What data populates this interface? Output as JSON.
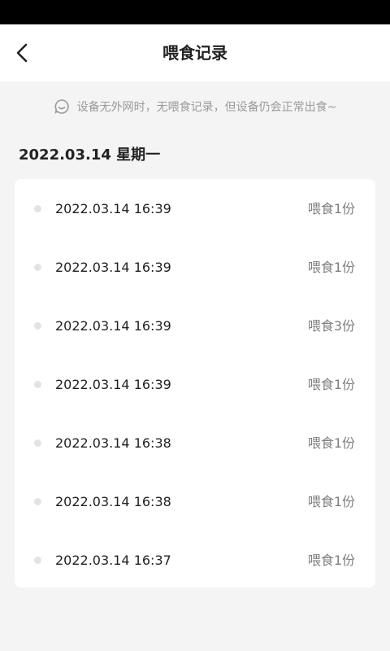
{
  "header": {
    "title": "喂食记录",
    "back_icon": "chevron-left-icon"
  },
  "notice": {
    "icon": "chat-bubble-icon",
    "text": "设备无外网时，无喂食记录，但设备仍会正常出食~"
  },
  "date_group": {
    "date_label": "2022.03.14 星期一",
    "records": [
      {
        "time": "2022.03.14 16:39",
        "amount": "喂食1份"
      },
      {
        "time": "2022.03.14 16:39",
        "amount": "喂食1份"
      },
      {
        "time": "2022.03.14 16:39",
        "amount": "喂食3份"
      },
      {
        "time": "2022.03.14 16:39",
        "amount": "喂食1份"
      },
      {
        "time": "2022.03.14 16:38",
        "amount": "喂食1份"
      },
      {
        "time": "2022.03.14 16:38",
        "amount": "喂食1份"
      },
      {
        "time": "2022.03.14 16:37",
        "amount": "喂食1份"
      }
    ]
  },
  "colors": {
    "page_background": "#f4f4f4",
    "card_background": "#ffffff",
    "primary_text": "#222222",
    "secondary_text": "#7e7e7e",
    "dot": "#e3e3e3"
  }
}
